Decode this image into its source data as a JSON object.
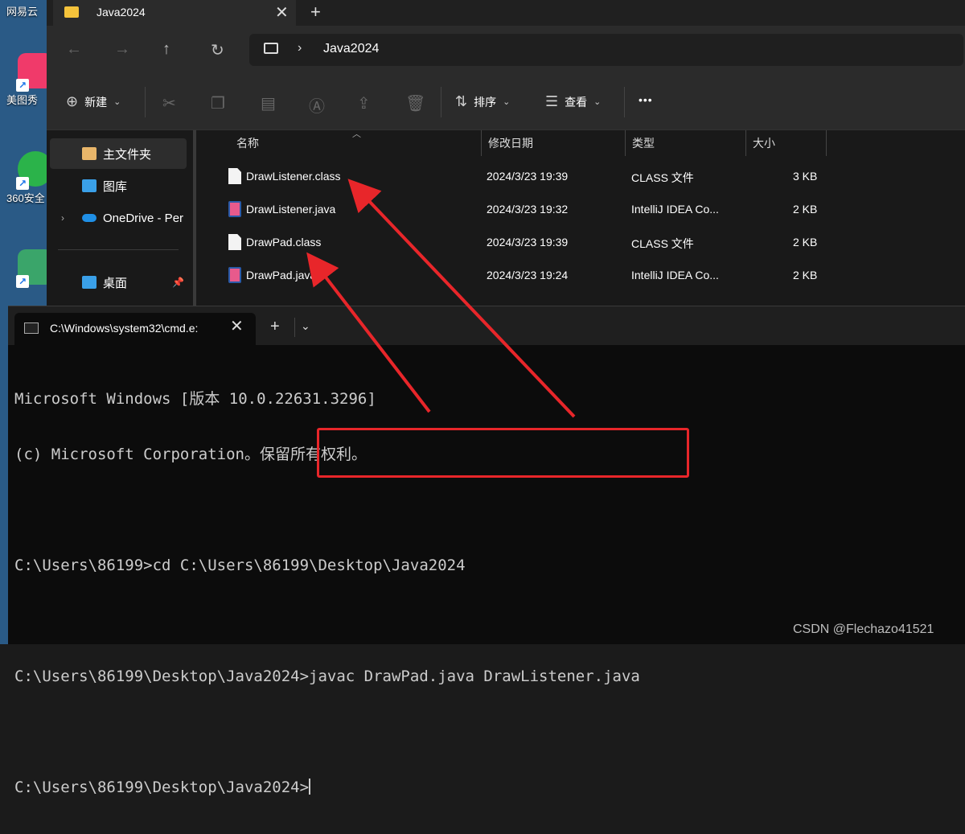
{
  "desktop": {
    "items": [
      {
        "label": "网易云",
        "color": "#d33a3a"
      },
      {
        "label": "美图秀",
        "color": "#f03a6a"
      },
      {
        "label": "360安全",
        "color": "#2bb34a"
      },
      {
        "label": "",
        "color": "#3aa56a"
      }
    ]
  },
  "explorer": {
    "tab_title": "Java2024",
    "address": {
      "path": "Java2024"
    },
    "commands": {
      "new_label": "新建",
      "sort_label": "排序",
      "view_label": "查看",
      "more": "•••"
    },
    "nav": [
      {
        "label": "主文件夹",
        "selected": true,
        "icon_color": "#e9b66a"
      },
      {
        "label": "图库",
        "selected": false,
        "icon_color": "#3aa0e8"
      },
      {
        "label": "OneDrive - Per",
        "selected": false,
        "icon_color": "#1f8fe6"
      },
      {
        "label": "桌面",
        "selected": false,
        "icon_color": "#3aa0e8"
      }
    ],
    "columns": {
      "name": "名称",
      "modified": "修改日期",
      "type": "类型",
      "size": "大小"
    },
    "files": [
      {
        "name": "DrawListener.class",
        "modified": "2024/3/23 19:39",
        "type": "CLASS 文件",
        "size": "3 KB",
        "kind": "class"
      },
      {
        "name": "DrawListener.java",
        "modified": "2024/3/23 19:32",
        "type": "IntelliJ IDEA Co...",
        "size": "2 KB",
        "kind": "java"
      },
      {
        "name": "DrawPad.class",
        "modified": "2024/3/23 19:39",
        "type": "CLASS 文件",
        "size": "2 KB",
        "kind": "class"
      },
      {
        "name": "DrawPad.java",
        "modified": "2024/3/23 19:24",
        "type": "IntelliJ IDEA Co...",
        "size": "2 KB",
        "kind": "java"
      }
    ]
  },
  "terminal": {
    "tab_title": "C:\\Windows\\system32\\cmd.e:",
    "lines": [
      "Microsoft Windows [版本 10.0.22631.3296]",
      "(c) Microsoft Corporation。保留所有权利。",
      "",
      "C:\\Users\\86199>cd C:\\Users\\86199\\Desktop\\Java2024",
      "",
      "C:\\Users\\86199\\Desktop\\Java2024>javac DrawPad.java DrawListener.java",
      "",
      "C:\\Users\\86199\\Desktop\\Java2024>"
    ]
  },
  "annotation_color": "#e8262a",
  "watermark": "CSDN @Flechazo41521"
}
